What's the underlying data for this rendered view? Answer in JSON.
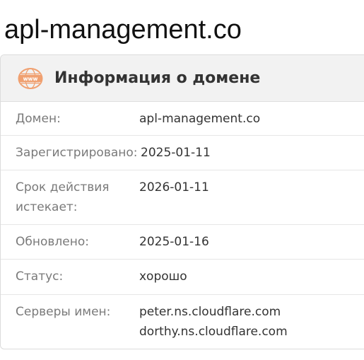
{
  "page": {
    "title": "apl-management.co"
  },
  "card": {
    "icon": "www-globe-icon",
    "title": "Информация о домене",
    "accent_color": "#f0a070"
  },
  "rows": [
    {
      "label": "Домен:",
      "values": [
        "apl-management.co"
      ]
    },
    {
      "label": "Зарегистрировано:",
      "values": [
        "2025-01-11"
      ]
    },
    {
      "label": "Срок действия истекает:",
      "values": [
        "2026-01-11"
      ]
    },
    {
      "label": "Обновлено:",
      "values": [
        "2025-01-16"
      ]
    },
    {
      "label": "Статус:",
      "values": [
        "хорошо"
      ]
    },
    {
      "label": "Серверы имен:",
      "values": [
        "peter.ns.cloudflare.com",
        "dorthy.ns.cloudflare.com"
      ]
    }
  ]
}
